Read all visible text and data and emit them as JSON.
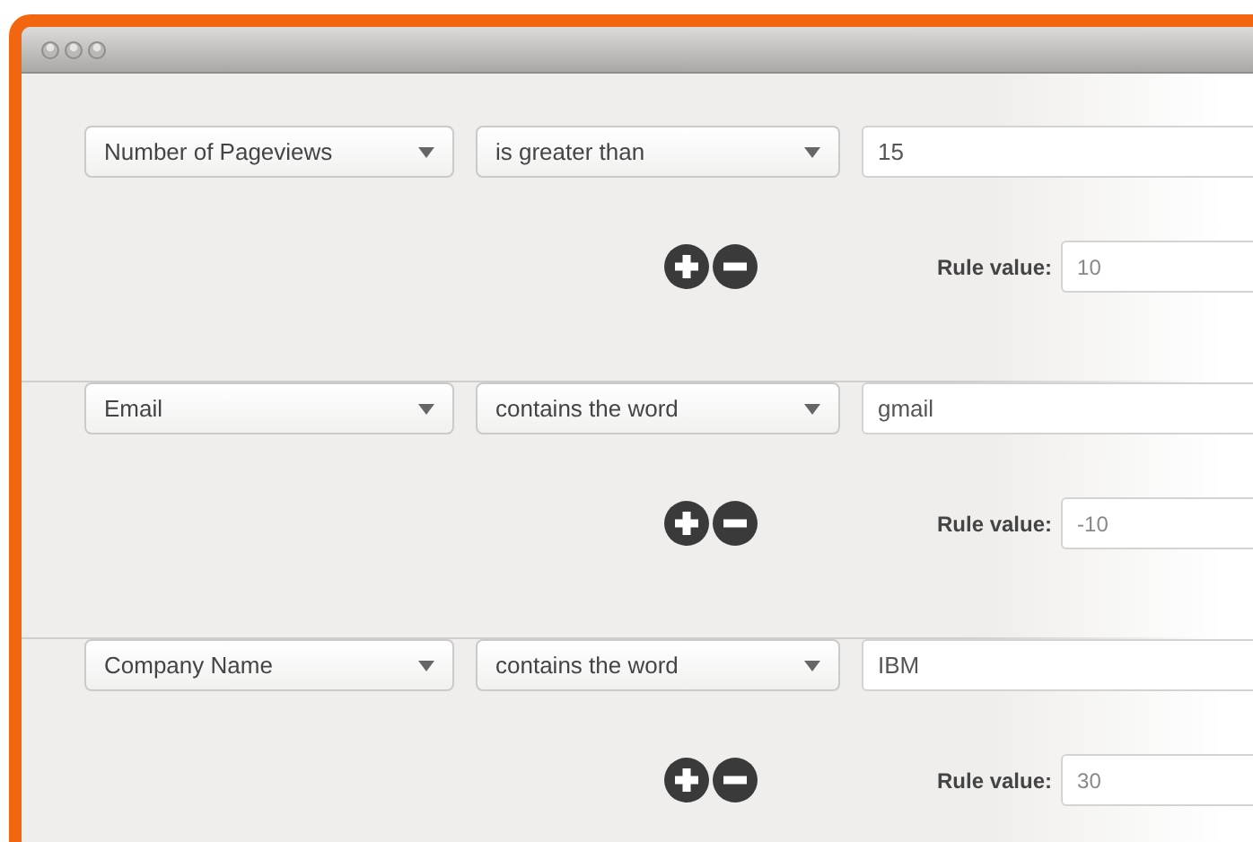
{
  "rules": [
    {
      "field": "Number of Pageviews",
      "operator": "is greater than",
      "value": "15",
      "rule_value_label": "Rule value:",
      "rule_value": "10"
    },
    {
      "field": "Email",
      "operator": "contains the word",
      "value": "gmail",
      "rule_value_label": "Rule value:",
      "rule_value": "-10"
    },
    {
      "field": "Company Name",
      "operator": "contains the word",
      "value": "IBM",
      "rule_value_label": "Rule value:",
      "rule_value": "30"
    }
  ]
}
